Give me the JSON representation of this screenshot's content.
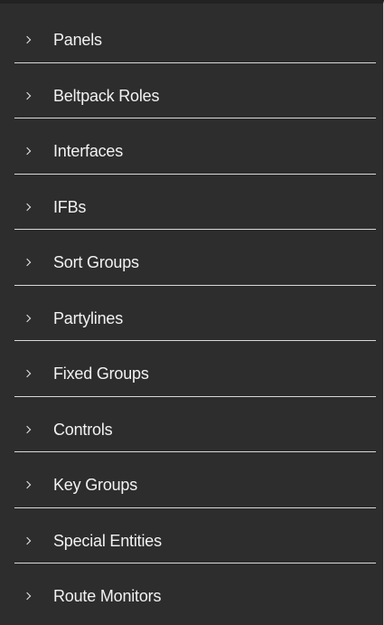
{
  "groups": {
    "items": [
      {
        "label": "Panels",
        "icon": "chevron-right-icon"
      },
      {
        "label": "Beltpack Roles",
        "icon": "chevron-right-icon"
      },
      {
        "label": "Interfaces",
        "icon": "chevron-right-icon"
      },
      {
        "label": "IFBs",
        "icon": "chevron-right-icon"
      },
      {
        "label": "Sort Groups",
        "icon": "chevron-right-icon"
      },
      {
        "label": "Partylines",
        "icon": "chevron-right-icon"
      },
      {
        "label": "Fixed Groups",
        "icon": "chevron-right-icon"
      },
      {
        "label": "Controls",
        "icon": "chevron-right-icon"
      },
      {
        "label": "Key Groups",
        "icon": "chevron-right-icon"
      },
      {
        "label": "Special Entities",
        "icon": "chevron-right-icon"
      },
      {
        "label": "Route Monitors",
        "icon": "chevron-right-icon"
      }
    ]
  },
  "colors": {
    "background": "#2d2d2d",
    "text": "#f2f2f2",
    "separator": "#d8d8d8"
  }
}
